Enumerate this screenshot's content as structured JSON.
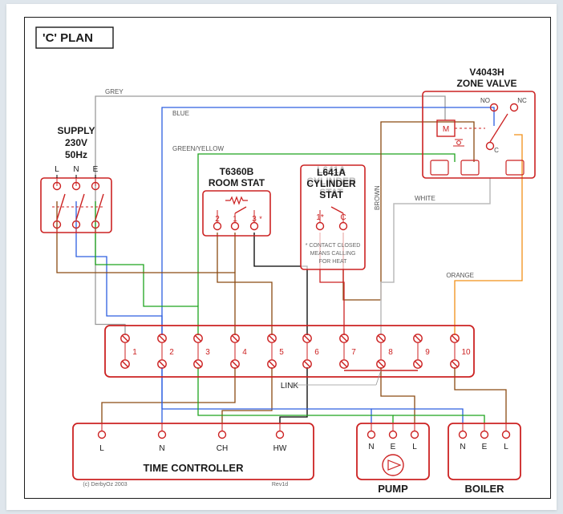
{
  "title": "'C' PLAN",
  "supply": {
    "label": "SUPPLY",
    "voltage": "230V",
    "freq": "50Hz",
    "terms": [
      "L",
      "N",
      "E"
    ]
  },
  "room_stat": {
    "model": "T6360B",
    "label": "ROOM STAT",
    "terms": [
      "2",
      "1",
      "3"
    ],
    "note_mark": "*"
  },
  "cyl_stat": {
    "model": "L641A",
    "label1": "CYLINDER",
    "label2": "STAT",
    "terms": [
      "1*",
      "C"
    ],
    "note1": "* CONTACT CLOSED",
    "note2": "MEANS CALLING",
    "note3": "FOR HEAT"
  },
  "zone_valve": {
    "model": "V4043H",
    "label": "ZONE VALVE",
    "motor": "M",
    "center": "C",
    "no": "NO",
    "nc": "NC"
  },
  "junction": {
    "terms": [
      "1",
      "2",
      "3",
      "4",
      "5",
      "6",
      "7",
      "8",
      "9",
      "10"
    ],
    "link": "LINK"
  },
  "time_controller": {
    "label": "TIME CONTROLLER",
    "terms": [
      "L",
      "N",
      "CH",
      "HW"
    ],
    "credit": "(c) DerbyOz 2003",
    "rev": "Rev1d"
  },
  "pump": {
    "label": "PUMP",
    "terms": [
      "N",
      "E",
      "L"
    ]
  },
  "boiler": {
    "label": "BOILER",
    "terms": [
      "N",
      "E",
      "L"
    ]
  },
  "wire_labels": {
    "grey": "GREY",
    "blue": "BLUE",
    "gy": "GREEN/YELLOW",
    "brown": "BROWN",
    "white": "WHITE",
    "orange": "ORANGE"
  }
}
